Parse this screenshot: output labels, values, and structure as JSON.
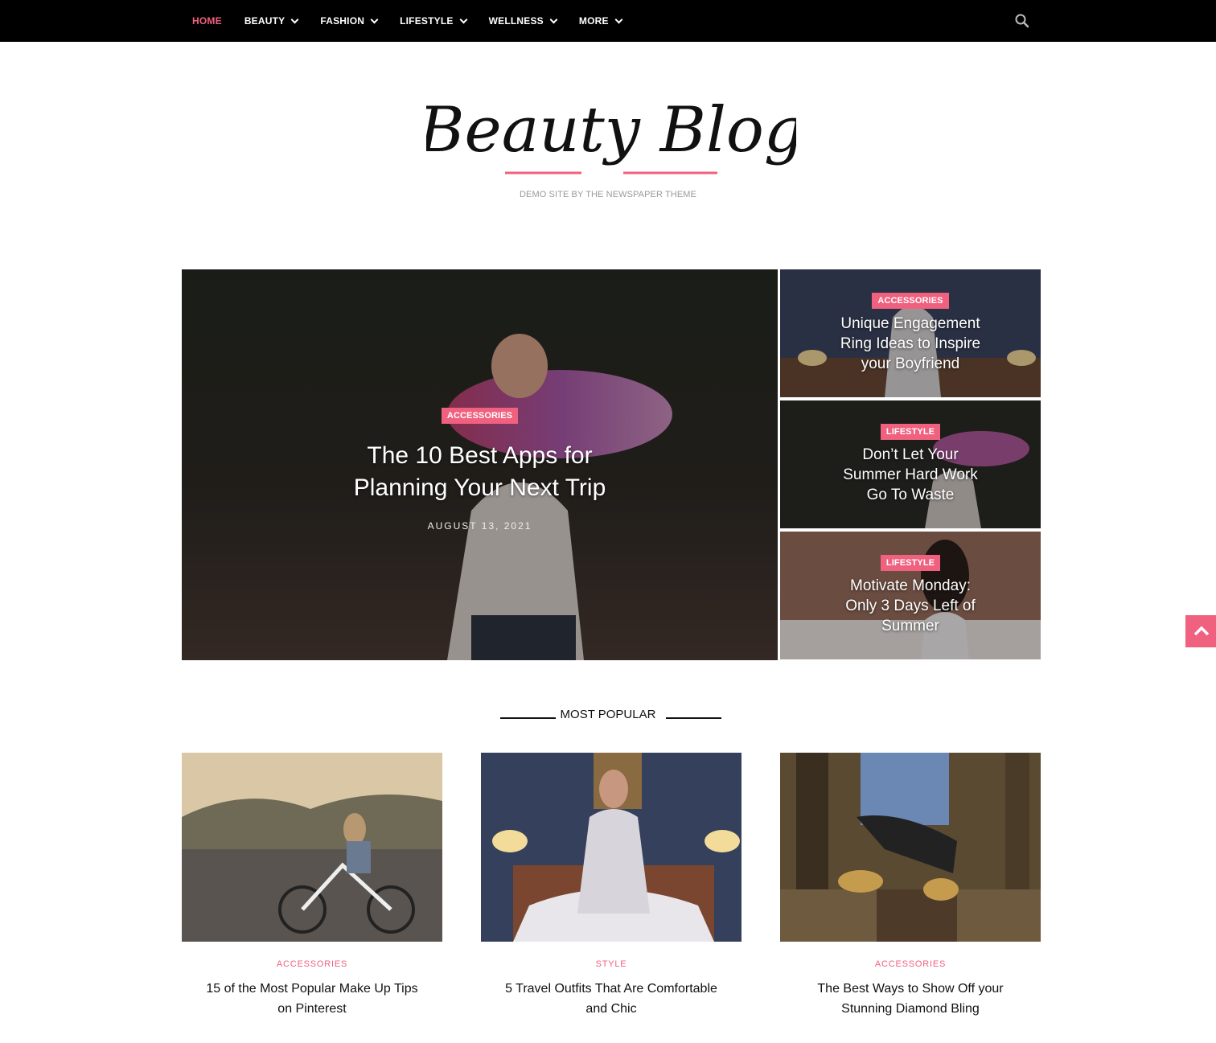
{
  "nav": {
    "items": [
      {
        "label": "HOME",
        "active": true,
        "dropdown": false
      },
      {
        "label": "BEAUTY",
        "active": false,
        "dropdown": true
      },
      {
        "label": "FASHION",
        "active": false,
        "dropdown": true
      },
      {
        "label": "LIFESTYLE",
        "active": false,
        "dropdown": true
      },
      {
        "label": "WELLNESS",
        "active": false,
        "dropdown": true
      },
      {
        "label": "MORE",
        "active": false,
        "dropdown": true
      }
    ],
    "search_icon": "search-icon"
  },
  "header": {
    "logo_text": "Beauty Blog",
    "tagline": "DEMO SITE BY THE NEWSPAPER THEME"
  },
  "featured": {
    "main": {
      "category": "ACCESSORIES",
      "title": "The 10 Best Apps for Planning Your Next Trip",
      "date": "AUGUST 13, 2021"
    },
    "side": [
      {
        "category": "ACCESSORIES",
        "title": "Unique Engagement Ring Ideas to Inspire your Boyfriend"
      },
      {
        "category": "LIFESTYLE",
        "title": "Don’t Let Your Summer Hard Work Go To Waste"
      },
      {
        "category": "LIFESTYLE",
        "title": "Motivate Monday: Only 3 Days Left of Summer"
      }
    ]
  },
  "most_popular": {
    "heading": "MOST POPULAR",
    "posts": [
      {
        "category": "ACCESSORIES",
        "title": "15 of the Most Popular Make Up Tips on Pinterest"
      },
      {
        "category": "STYLE",
        "title": "5 Travel Outfits That Are Comfortable and Chic"
      },
      {
        "category": "ACCESSORIES",
        "title": "The Best Ways to Show Off your Stunning Diamond Bling"
      }
    ]
  },
  "colors": {
    "accent": "#f0607f",
    "nav_bg": "#000000"
  },
  "back_to_top_icon": "chevron-up-icon"
}
